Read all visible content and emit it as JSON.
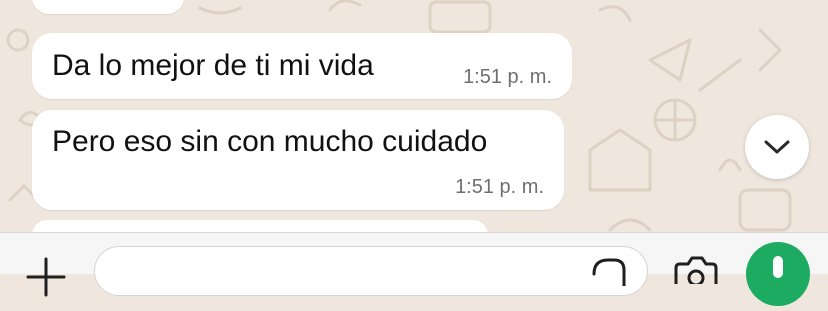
{
  "chat": {
    "messages": [
      {
        "text": "Da lo mejor de ti mi vida",
        "time": "1:51 p. m."
      },
      {
        "text": "Pero eso sin con mucho cuidado",
        "time": "1:51 p. m."
      }
    ]
  },
  "colors": {
    "wallpaper": "#efe6dd",
    "bubble": "#ffffff",
    "send_green": "#1daa61"
  },
  "icons": {
    "scroll_down": "chevron-down-icon",
    "attach": "plus-icon",
    "sticker": "sticker-icon",
    "camera": "camera-icon",
    "mic": "mic-icon"
  }
}
